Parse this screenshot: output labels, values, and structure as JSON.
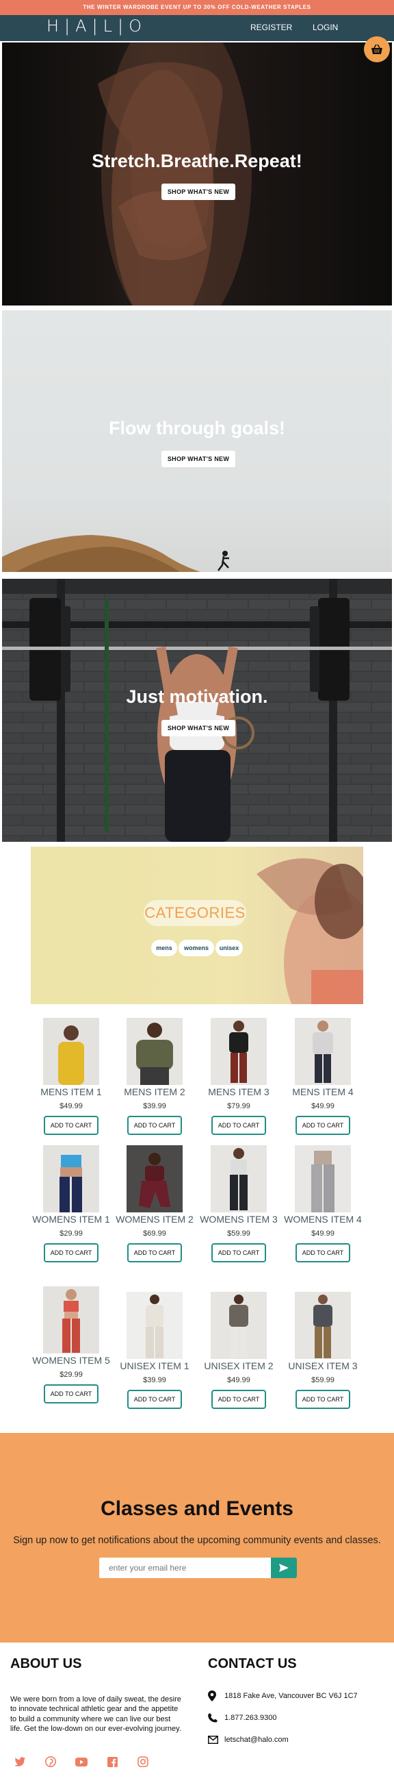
{
  "promo": {
    "text": "THE WINTER WARDROBE EVENT UP TO 30% OFF COLD-WEATHER STAPLES"
  },
  "header": {
    "logo": "H|A|L|O",
    "register_label": "REGISTER",
    "login_label": "LOGIN",
    "cart_icon": "basket-icon"
  },
  "heroes": [
    {
      "title": "Stretch.Breathe.Repeat!",
      "button_label": "SHOP WHAT'S NEW"
    },
    {
      "title": "Flow through goals!",
      "button_label": "SHOP WHAT'S NEW"
    },
    {
      "title": "Just motivation.",
      "button_label": "SHOP WHAT'S NEW"
    }
  ],
  "categories": {
    "title": "CATEGORIES",
    "chips": [
      "mens",
      "womens",
      "unisex"
    ]
  },
  "products": [
    {
      "name": "MENS ITEM 1",
      "price": "$49.99",
      "button": "ADD TO CART"
    },
    {
      "name": "MENS ITEM 2",
      "price": "$39.99",
      "button": "ADD TO CART"
    },
    {
      "name": "MENS ITEM 3",
      "price": "$79.99",
      "button": "ADD TO CART"
    },
    {
      "name": "MENS ITEM 4",
      "price": "$49.99",
      "button": "ADD TO CART"
    },
    {
      "name": "WOMENS ITEM 1",
      "price": "$29.99",
      "button": "ADD TO CART"
    },
    {
      "name": "WOMENS ITEM 2",
      "price": "$69.99",
      "button": "ADD TO CART"
    },
    {
      "name": "WOMENS ITEM 3",
      "price": "$59.99",
      "button": "ADD TO CART"
    },
    {
      "name": "WOMENS ITEM 4",
      "price": "$49.99",
      "button": "ADD TO CART"
    },
    {
      "name": "WOMENS ITEM 5",
      "price": "$29.99",
      "button": "ADD TO CART"
    },
    {
      "name": "UNISEX ITEM 1",
      "price": "$39.99",
      "button": "ADD TO CART"
    },
    {
      "name": "UNISEX ITEM 2",
      "price": "$49.99",
      "button": "ADD TO CART"
    },
    {
      "name": "UNISEX ITEM 3",
      "price": "$59.99",
      "button": "ADD TO CART"
    }
  ],
  "events": {
    "title": "Classes and Events",
    "subtitle": "Sign up now to get notifications about the upcoming community events and classes.",
    "email_placeholder": "enter your email here",
    "submit_icon": "send-icon"
  },
  "about": {
    "heading": "ABOUT US",
    "text": "We were born from a love of daily sweat, the desire to innovate technical athletic gear and the appetite to build a community where we can live our best life. Get the low-down on our ever-evolving journey."
  },
  "contact": {
    "heading": "CONTACT US",
    "address": "1818 Fake Ave, Vancouver BC V6J 1C7",
    "phone": "1.877.263.9300",
    "email": "letschat@halo.com"
  },
  "social_icons": [
    "twitter-icon",
    "pinterest-icon",
    "youtube-icon",
    "facebook-icon",
    "instagram-icon"
  ],
  "colors": {
    "promo_bg": "#e97a5f",
    "header_bg": "#2c4a55",
    "accent_orange": "#f2a14e",
    "events_bg": "#f3a25f",
    "button_border_teal": "#1f8f86",
    "social_icon": "#ee7f64"
  }
}
